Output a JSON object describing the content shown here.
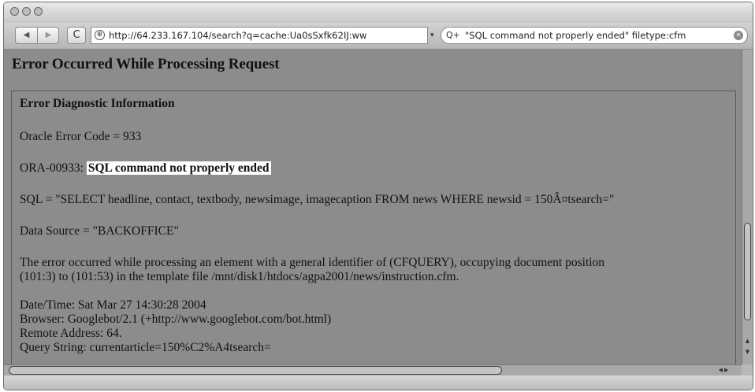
{
  "browser": {
    "back_icon": "◀",
    "forward_icon": "▶",
    "reload_icon": "C",
    "url": "http://64.233.167.104/search?q=cache:Ua0sSxfk62IJ:ww",
    "search_icon": "Q+",
    "search_query": "\"SQL command not properly ended\" filetype:cfm",
    "icons": [
      "back-arrow-icon",
      "forward-arrow-icon",
      "reload-icon",
      "globe-icon",
      "url-dropdown-icon",
      "search-icon",
      "search-clear-icon",
      "scroll-up-icon",
      "scroll-down-icon",
      "scroll-left-icon",
      "scroll-right-icon"
    ]
  },
  "page": {
    "title": "Error Occurred While Processing Request",
    "diagnostic_heading": "Error Diagnostic Information",
    "oracle_error_code": "Oracle Error Code = 933",
    "ora_prefix": "ORA-00933:",
    "ora_message": "SQL command not properly ended",
    "sql": "SQL = \"SELECT headline, contact, textbody, newsimage, imagecaption FROM news WHERE newsid = 150Â¤tsearch=\"",
    "data_source": "Data Source = \"BACKOFFICE\"",
    "error_line1": "The error occurred while processing an element with a general identifier of (CFQUERY), occupying document position",
    "error_line2": "(101:3) to (101:53) in the template file /mnt/disk1/htdocs/agpa2001/news/instruction.cfm.",
    "datetime": "Date/Time: Sat Mar 27 14:30:28 2004",
    "browser_agent": "Browser: Googlebot/2.1 (+http://www.googlebot.com/bot.html)",
    "remote_address": "Remote Address: 64.",
    "query_string": "Query String: currentarticle=150%C2%A4tsearch="
  },
  "colors": {
    "content_background": "#8c8c8c",
    "highlight_background": "#ffffff",
    "chrome": "#cfcfcf"
  }
}
